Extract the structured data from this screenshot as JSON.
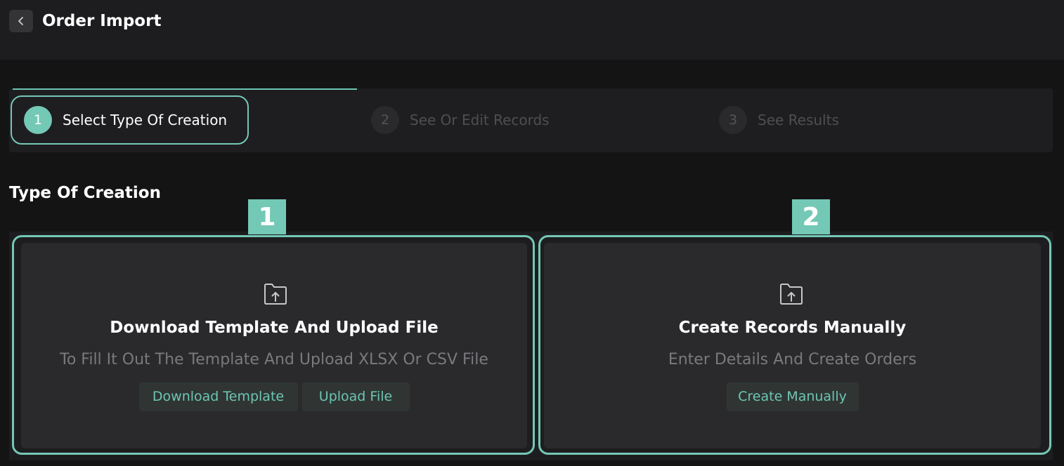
{
  "header": {
    "back_icon": "chevron-left-icon",
    "title": "Order Import"
  },
  "stepper": {
    "steps": [
      {
        "number": "1",
        "label": "Select Type Of Creation",
        "state": "active"
      },
      {
        "number": "2",
        "label": "See Or Edit Records",
        "state": "inactive"
      },
      {
        "number": "3",
        "label": "See Results",
        "state": "inactive"
      }
    ]
  },
  "section": {
    "title": "Type Of Creation"
  },
  "markers": [
    "1",
    "2"
  ],
  "cards": [
    {
      "icon": "folder-upload-icon",
      "title": "Download Template And Upload File",
      "description": "To Fill It Out The Template And Upload XLSX Or CSV File",
      "buttons": [
        "Download Template",
        "Upload File"
      ]
    },
    {
      "icon": "folder-upload-icon",
      "title": "Create Records Manually",
      "description": "Enter Details And Create Orders",
      "buttons": [
        "Create Manually"
      ]
    }
  ],
  "colors": {
    "accent": "#74c8b6",
    "background": "#141415",
    "panel": "#1d1d1f",
    "card": "#2a2a2c",
    "muted_text": "#7a7a7e"
  }
}
